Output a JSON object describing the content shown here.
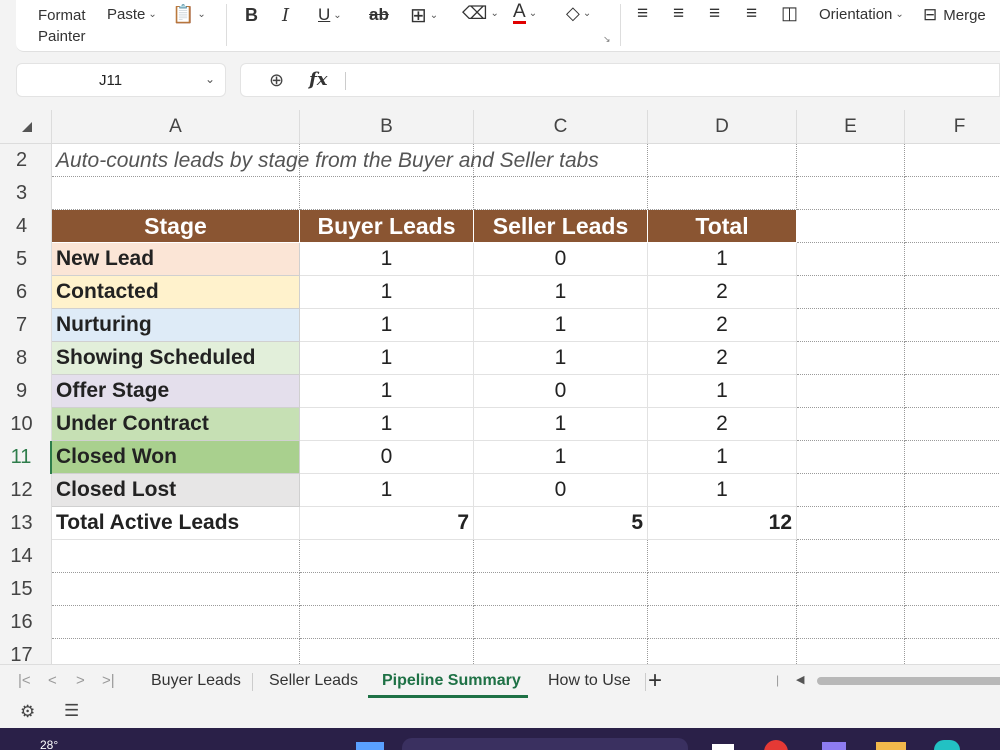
{
  "ribbon": {
    "format_painter": [
      "Format",
      "Painter"
    ],
    "paste": "Paste",
    "bold": "B",
    "italic": "I",
    "underline": "U",
    "strikethrough": "ab",
    "orientation": "Orientation",
    "merge": "Merge"
  },
  "formula_bar": {
    "name_box": "J11",
    "fx": "fx",
    "formula": ""
  },
  "columns": [
    "A",
    "B",
    "C",
    "D",
    "E",
    "F"
  ],
  "rows": [
    "2",
    "3",
    "4",
    "5",
    "6",
    "7",
    "8",
    "9",
    "10",
    "11",
    "12",
    "13",
    "14",
    "15",
    "16",
    "17"
  ],
  "active_row": "11",
  "sheet": {
    "note": "Auto-counts leads by stage from the Buyer and Seller tabs",
    "headers": [
      "Stage",
      "Buyer Leads",
      "Seller Leads",
      "Total"
    ],
    "stages": [
      {
        "name": "New Lead",
        "buyer": "1",
        "seller": "0",
        "total": "1",
        "color": "#fbe5d6"
      },
      {
        "name": "Contacted",
        "buyer": "1",
        "seller": "1",
        "total": "2",
        "color": "#fff2cc"
      },
      {
        "name": "Nurturing",
        "buyer": "1",
        "seller": "1",
        "total": "2",
        "color": "#deebf7"
      },
      {
        "name": "Showing Scheduled",
        "buyer": "1",
        "seller": "1",
        "total": "2",
        "color": "#e2efda"
      },
      {
        "name": "Offer Stage",
        "buyer": "1",
        "seller": "0",
        "total": "1",
        "color": "#e4dfec"
      },
      {
        "name": "Under Contract",
        "buyer": "1",
        "seller": "1",
        "total": "2",
        "color": "#c6e0b4"
      },
      {
        "name": "Closed Won",
        "buyer": "0",
        "seller": "1",
        "total": "1",
        "color": "#a9d08e"
      },
      {
        "name": "Closed Lost",
        "buyer": "1",
        "seller": "0",
        "total": "1",
        "color": "#e7e6e6"
      }
    ],
    "totals": {
      "label": "Total Active Leads",
      "buyer": "7",
      "seller": "5",
      "total": "12"
    },
    "header_color": "#8a5532"
  },
  "tabs": [
    "Buyer Leads",
    "Seller Leads",
    "Pipeline Summary",
    "How to Use"
  ],
  "active_tab": "Pipeline Summary",
  "taskbar": {
    "weather": "28°"
  }
}
